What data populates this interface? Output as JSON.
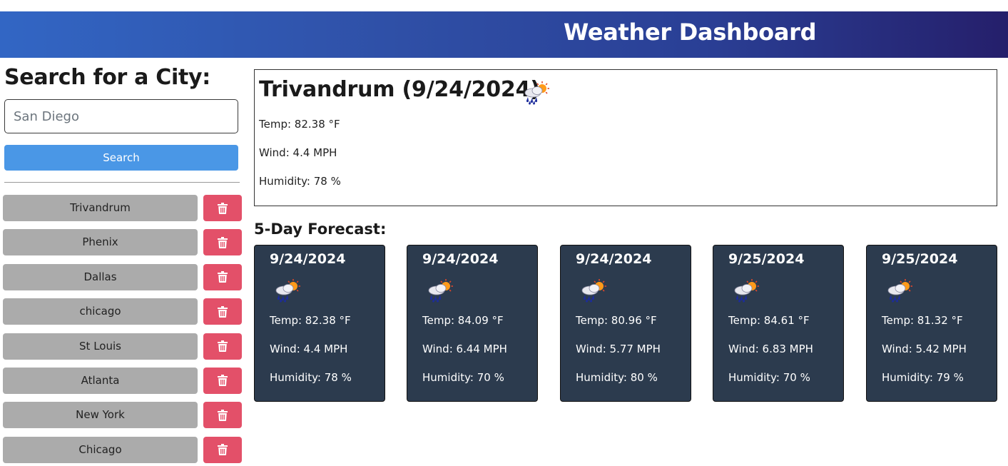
{
  "header": {
    "title": "Weather Dashboard"
  },
  "search": {
    "heading": "Search for a City:",
    "placeholder": "San Diego",
    "button_label": "Search"
  },
  "history": [
    {
      "label": "Trivandrum"
    },
    {
      "label": "Phenix"
    },
    {
      "label": "Dallas"
    },
    {
      "label": "chicago"
    },
    {
      "label": "St Louis"
    },
    {
      "label": "Atlanta"
    },
    {
      "label": "New York"
    },
    {
      "label": "Chicago"
    }
  ],
  "current": {
    "title": "Trivandrum (9/24/2024)",
    "icon": "rain-sun-cloud-icon",
    "temp": "Temp: 82.38 °F",
    "wind": "Wind: 4.4 MPH",
    "humidity": "Humidity: 78 %"
  },
  "forecast": {
    "heading": "5-Day Forecast:",
    "days": [
      {
        "date": "9/24/2024",
        "icon": "rain-sun-cloud-icon",
        "temp": "Temp: 82.38 °F",
        "wind": "Wind: 4.4 MPH",
        "humidity": "Humidity: 78 %"
      },
      {
        "date": "9/24/2024",
        "icon": "rain-sun-cloud-icon",
        "temp": "Temp: 84.09 °F",
        "wind": "Wind: 6.44 MPH",
        "humidity": "Humidity: 70 %"
      },
      {
        "date": "9/24/2024",
        "icon": "rain-sun-cloud-icon",
        "temp": "Temp: 80.96 °F",
        "wind": "Wind: 5.77 MPH",
        "humidity": "Humidity: 80 %"
      },
      {
        "date": "9/25/2024",
        "icon": "rain-sun-cloud-icon",
        "temp": "Temp: 84.61 °F",
        "wind": "Wind: 6.83 MPH",
        "humidity": "Humidity: 70 %"
      },
      {
        "date": "9/25/2024",
        "icon": "rain-sun-cloud-icon",
        "temp": "Temp: 81.32 °F",
        "wind": "Wind: 5.42 MPH",
        "humidity": "Humidity: 79 %"
      }
    ]
  },
  "colors": {
    "search_button": "#4a97e6",
    "delete_button": "#e35069",
    "city_button": "#ababab",
    "forecast_card": "#2c3b4e"
  }
}
